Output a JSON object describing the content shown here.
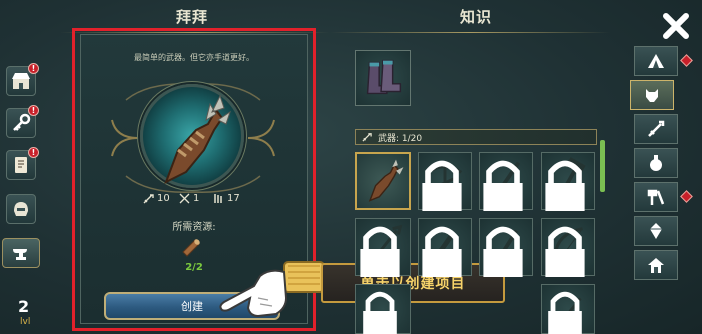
{
  "header": {
    "recipe_title": "拜拜",
    "knowledge_title": "知识"
  },
  "recipe": {
    "description": "最简单的武器。但它亦手道更好。",
    "stats": [
      {
        "icon": "sword-icon",
        "value": "10"
      },
      {
        "icon": "crossed-swords-icon",
        "value": "1"
      },
      {
        "icon": "durability-icon",
        "value": "17"
      }
    ],
    "resources_label": "所需资源:",
    "resource_count": "2/2",
    "create_label": "创建"
  },
  "tutorial": {
    "tooltip": "单击以创建项目"
  },
  "knowledge": {
    "category_label": "武器: 1/20"
  },
  "player": {
    "level": "2",
    "level_label": "lvl"
  },
  "sidebar": {
    "badge": "!"
  },
  "colors": {
    "highlight_frame": "#e2212b",
    "tooltip_text": "#f7d36a",
    "resource_ok": "#7ac93e",
    "notification": "#c8202a"
  }
}
